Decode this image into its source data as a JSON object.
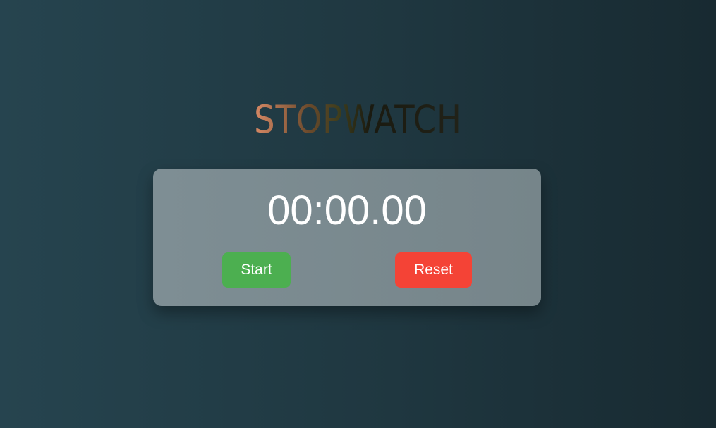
{
  "title": "STOPWATCH",
  "display": {
    "time": "00:00.00"
  },
  "controls": {
    "start_label": "Start",
    "reset_label": "Reset"
  },
  "colors": {
    "start": "#4caf50",
    "reset": "#f44336",
    "card": "#7e8e94",
    "background": "#26444f"
  }
}
